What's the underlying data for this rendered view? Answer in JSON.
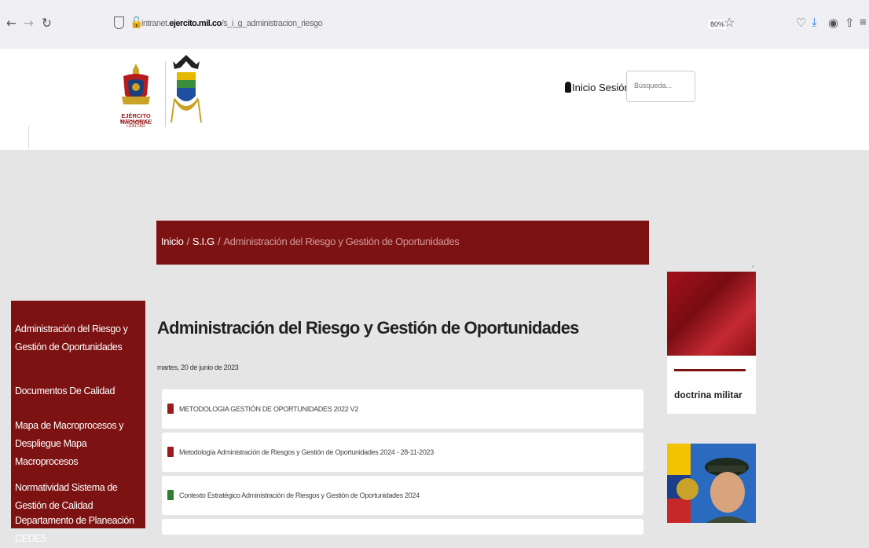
{
  "browser": {
    "url_prefix": "intranet.",
    "url_domain": "ejercito.mil.co",
    "url_path": "/s_i_g_administracion_riesgo",
    "zoom": "80%"
  },
  "header": {
    "logo_text": "EJÉRCITO NACIONAL",
    "logo_motto": "PATRIA HONOR LEALTAD",
    "login_label": "Inicio Sesión",
    "search_placeholder": "Búsqueda..."
  },
  "breadcrumb": {
    "home": "Inicio",
    "section": "S.I.G",
    "current": "Administración del Riesgo y Gestión de Oportunidades"
  },
  "sidebar": {
    "items": [
      "Administración del Riesgo y Gestión de Oportunidades",
      "Documentos De Calidad",
      "Mapa de Macroprocesos y Despliegue Mapa Macroprocesos",
      "Normatividad Sistema de Gestión de Calidad",
      "Departamento de Planeación CEDE5"
    ]
  },
  "main": {
    "title": "Administración del Riesgo y Gestión de Oportunidades",
    "date": "martes, 20 de junio de 2023",
    "documents": [
      {
        "label": "METODOLOGIA GESTIÓN DE OPORTUNIDADES 2022 V2",
        "type": "pdf"
      },
      {
        "label": "Metodología Administración de Riesgos y Gestión de Oportunidades 2024 - 28-11-2023",
        "type": "pdf"
      },
      {
        "label": "Contexto Estratégico Administración de Riesgos y Gestión de Oportunidades 2024",
        "type": "excel"
      }
    ]
  },
  "right": {
    "card_title": "doctrina militar"
  },
  "colors": {
    "brand": "#7d1212",
    "pdf": "#9a1b1b",
    "excel": "#2e7d32"
  }
}
